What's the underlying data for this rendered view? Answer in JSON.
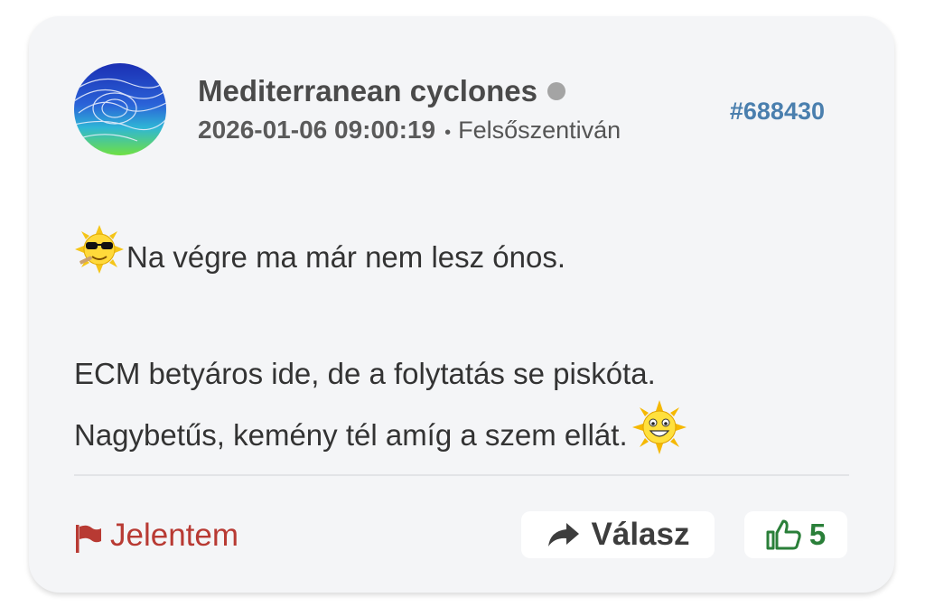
{
  "post": {
    "author": "Mediterranean cyclones",
    "timestamp": "2026-01-06 09:00:19",
    "separator": "•",
    "location": "Felsőszentiván",
    "id": "#688430",
    "body": {
      "line1": "Na végre ma már nem lesz ónos.",
      "line2": "ECM betyáros ide, de a folytatás se piskóta.",
      "line3": "Nagybetűs, kemény tél amíg a szem ellát."
    }
  },
  "actions": {
    "report_label": "Jelentem",
    "reply_label": "Válasz",
    "like_count": "5"
  },
  "icons": {
    "avatar": "weather-map-avatar",
    "status": "status-dot",
    "emoji1": "cool-sun-emoji",
    "emoji2": "smiling-sun-emoji",
    "report": "flag-icon",
    "reply": "reply-arrow-icon",
    "like": "thumbs-up-icon"
  },
  "colors": {
    "report": "#b83a33",
    "post_id": "#4a7fae",
    "like": "#2a7f39",
    "card_bg": "#f4f5f7"
  }
}
